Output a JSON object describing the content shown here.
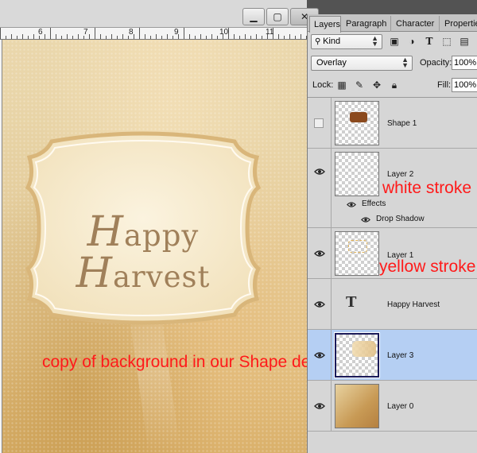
{
  "window": {
    "minimize_glyph": "▁",
    "maximize_glyph": "▢",
    "close_glyph": "✕"
  },
  "ruler": {
    "labels": [
      "6",
      "7",
      "8",
      "9",
      "10",
      "11"
    ]
  },
  "canvas": {
    "happy_cap": "H",
    "happy_rest": "appy",
    "harvest_cap": "H",
    "harvest_rest": "arvest"
  },
  "annotations": {
    "white_stroke": "white stroke",
    "yellow_stroke": "yellow stroke",
    "copy_background": "copy of background in our Shape design"
  },
  "panel": {
    "tabs": [
      "Layers",
      "Paragraph",
      "Character",
      "Properties"
    ],
    "filter": {
      "label": "Kind"
    },
    "blend_mode": "Overlay",
    "opacity_label": "Opacity:",
    "opacity_value": "100%",
    "lock_label": "Lock:",
    "fill_label": "Fill:",
    "fill_value": "100%"
  },
  "layers": [
    {
      "name": "Shape 1",
      "visible": false
    },
    {
      "name": "Layer 2",
      "visible": true,
      "effects_label": "Effects",
      "effect_items": [
        "Drop Shadow"
      ]
    },
    {
      "name": "Layer 1",
      "visible": true
    },
    {
      "name": "Happy Harvest",
      "visible": true,
      "type_glyph": "T"
    },
    {
      "name": "Layer 3",
      "visible": true,
      "selected": true
    },
    {
      "name": "Layer 0",
      "visible": true
    }
  ],
  "colors": {
    "annotation": "#ff1a1a",
    "selected_row": "#b5cff3",
    "frame_stroke": "#d9b67a",
    "shape_thumb": "#8b4a1e"
  }
}
